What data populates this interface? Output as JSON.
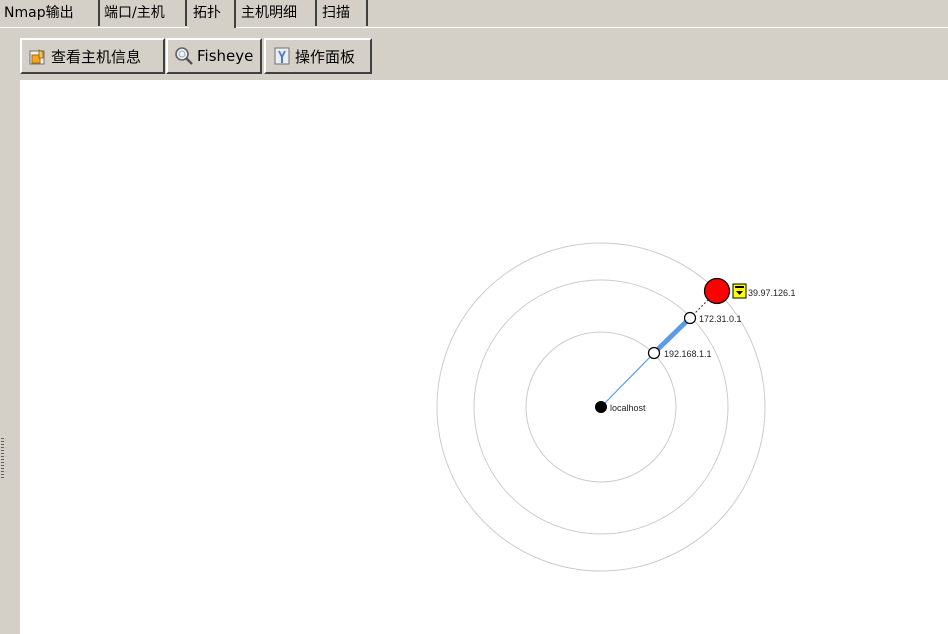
{
  "tabs": [
    {
      "label": "Nmap输出",
      "active": false
    },
    {
      "label": "端口/主机",
      "active": false
    },
    {
      "label": "拓扑",
      "active": true
    },
    {
      "label": "主机明细",
      "active": false
    },
    {
      "label": "扫描",
      "active": false
    }
  ],
  "toolbar": {
    "host_info_label": "查看主机信息",
    "fisheye_label": "Fisheye",
    "control_panel_label": "操作面板"
  },
  "topology": {
    "nodes": [
      {
        "id": "localhost",
        "label": "localhost"
      },
      {
        "id": "gw1",
        "label": "192.168.1.1"
      },
      {
        "id": "gw2",
        "label": "172.31.0.1"
      },
      {
        "id": "target",
        "label": "39.97.126.1"
      }
    ],
    "colors": {
      "ring": "#cccccc",
      "link": "#5b9bea",
      "target": "#ff0000",
      "firewall_badge": "#ffff00"
    }
  }
}
